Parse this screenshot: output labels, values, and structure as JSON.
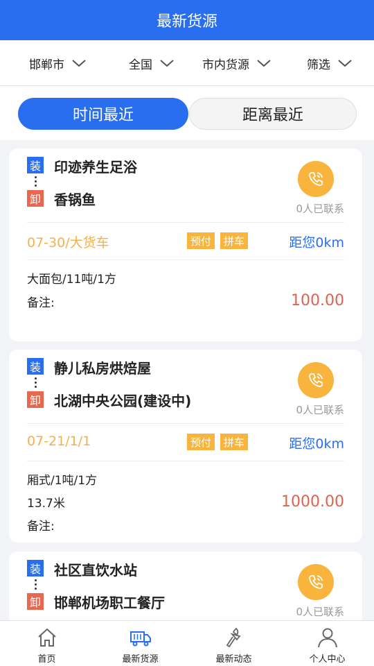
{
  "header": {
    "title": "最新货源"
  },
  "filters": [
    {
      "label": "邯郸市"
    },
    {
      "label": "全国"
    },
    {
      "label": "市内货源"
    },
    {
      "label": "筛选"
    }
  ],
  "sort": {
    "active": "时间最近",
    "inactive": "距离最近"
  },
  "tags": {
    "load": "装",
    "unload": "卸"
  },
  "cards": [
    {
      "from": "印迹养生足浴",
      "to": "香锅鱼",
      "contacted": "0人已联系",
      "date_vehicle": "07-30/大货车",
      "badges": [
        "预付",
        "拼车"
      ],
      "distance": "距您0km",
      "cargo": "大面包/11吨/1方",
      "length": "",
      "note": "备注:",
      "price": "100.00"
    },
    {
      "from": "静儿私房烘焙屋",
      "to": "北湖中央公园(建设中)",
      "contacted": "0人已联系",
      "date_vehicle": "07-21/1/1",
      "badges": [
        "预付",
        "拼车"
      ],
      "distance": "距您0km",
      "cargo": "厢式/1吨/1方",
      "length": "13.7米",
      "note": "备注:",
      "price": "1000.00"
    },
    {
      "from": "社区直饮水站",
      "to": "邯郸机场职工餐厅",
      "contacted": "0人已联系"
    }
  ],
  "tabbar": [
    {
      "label": "首页",
      "icon": "home-icon"
    },
    {
      "label": "最新货源",
      "icon": "truck-icon",
      "active": true
    },
    {
      "label": "最新动态",
      "icon": "torch-icon"
    },
    {
      "label": "个人中心",
      "icon": "user-icon"
    }
  ],
  "colors": {
    "primary": "#2a6ef0",
    "orange": "#f8b43c",
    "price": "#e0624a",
    "unload": "#e8674f"
  }
}
